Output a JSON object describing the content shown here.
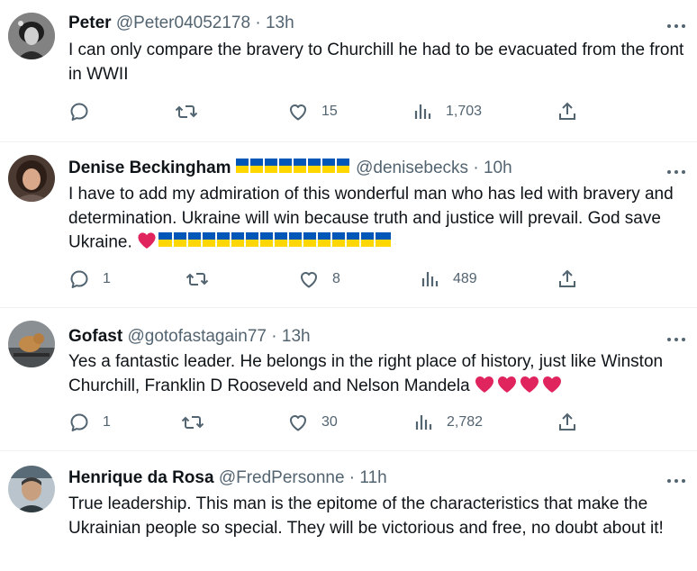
{
  "tweets": [
    {
      "name": "Peter",
      "handle": "@Peter04052178",
      "time": "13h",
      "text": "I can only compare the bravery to  Churchill he had to be evacuated from the front in WWII",
      "replies": "",
      "retweets": "",
      "likes": "15",
      "views": "1,703"
    },
    {
      "name": "Denise Beckingham",
      "handle": "@denisebecks",
      "time": "10h",
      "text": "I have to add my admiration of this wonderful man who has led with bravery and determination. Ukraine will win because truth and justice will prevail. God save Ukraine.",
      "replies": "1",
      "retweets": "",
      "likes": "8",
      "views": "489"
    },
    {
      "name": "Gofast",
      "handle": "@gotofastagain77",
      "time": "13h",
      "text": "Yes a fantastic leader. He belongs in the right place of history, just like Winston Churchill, Franklin D Rooseveld and Nelson Mandela",
      "replies": "1",
      "retweets": "",
      "likes": "30",
      "views": "2,782"
    },
    {
      "name": "Henrique da Rosa",
      "handle": "@FredPersonne",
      "time": "11h",
      "text": "True leadership. This man is the epitome of the characteristics that make the Ukrainian people so special. They will be victorious and free, no doubt about it!",
      "replies": "",
      "retweets": "",
      "likes": "",
      "views": ""
    }
  ],
  "separator": " · ",
  "colors": {
    "text": "#0f1419",
    "secondary": "#536471",
    "divider": "#eff3f4",
    "flag_blue": "#0057b7",
    "flag_yellow": "#ffd700",
    "heart": "#e0245e"
  },
  "icons": [
    "more-icon",
    "reply-icon",
    "retweet-icon",
    "like-icon",
    "views-icon",
    "share-icon",
    "ukraine-flag-icon",
    "red-heart-icon"
  ]
}
